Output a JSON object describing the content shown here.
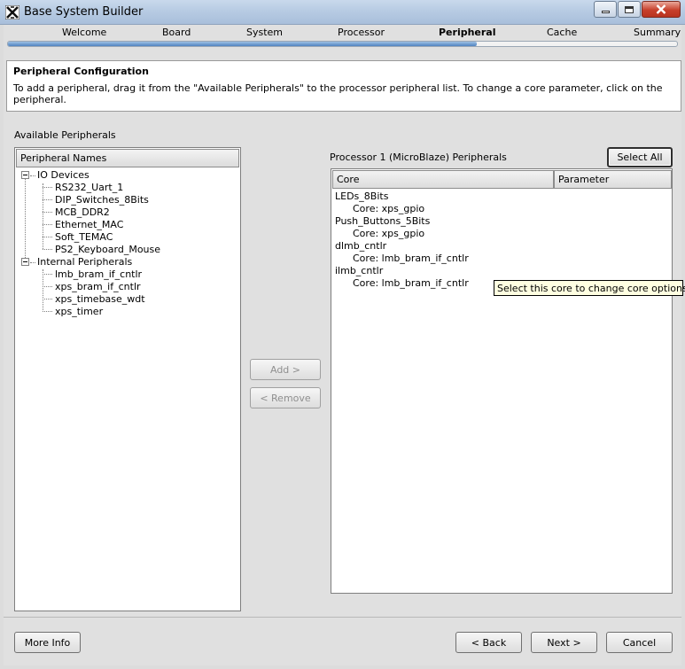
{
  "window": {
    "title": "Base System Builder",
    "icon": "xilinx-app-icon",
    "controls": [
      "minimize-icon",
      "maximize-icon",
      "close-icon"
    ]
  },
  "steps": {
    "items": [
      "Welcome",
      "Board",
      "System",
      "Processor",
      "Peripheral",
      "Cache",
      "Summary"
    ],
    "active": "Peripheral",
    "progress": 0.7
  },
  "header": {
    "title": "Peripheral Configuration",
    "description": "To add a peripheral, drag it from the \"Available Peripherals\" to the processor peripheral list. To change a core parameter, click on the peripheral."
  },
  "available": {
    "label": "Available Peripherals",
    "column": "Peripheral Names",
    "groups": [
      {
        "name": "IO Devices",
        "items": [
          "RS232_Uart_1",
          "DIP_Switches_8Bits",
          "MCB_DDR2",
          "Ethernet_MAC",
          "Soft_TEMAC",
          "PS2_Keyboard_Mouse"
        ]
      },
      {
        "name": "Internal Peripherals",
        "items": [
          "lmb_bram_if_cntlr",
          "xps_bram_if_cntlr",
          "xps_timebase_wdt",
          "xps_timer"
        ]
      }
    ]
  },
  "actions": {
    "add": "Add >",
    "remove": "< Remove"
  },
  "processor": {
    "label": "Processor 1 (MicroBlaze) Peripherals",
    "select_all": "Select All",
    "columns": [
      "Core",
      "Parameter"
    ],
    "peripherals": [
      {
        "name": "LEDs_8Bits",
        "core": "Core: xps_gpio"
      },
      {
        "name": "Push_Buttons_5Bits",
        "core": "Core: xps_gpio"
      },
      {
        "name": "dlmb_cntlr",
        "core": "Core: lmb_bram_if_cntlr"
      },
      {
        "name": "ilmb_cntlr",
        "core": "Core: lmb_bram_if_cntlr"
      }
    ]
  },
  "tooltip": "Select this core to change core options",
  "footer": {
    "more_info": "More Info",
    "back": "< Back",
    "next": "Next >",
    "cancel": "Cancel"
  }
}
